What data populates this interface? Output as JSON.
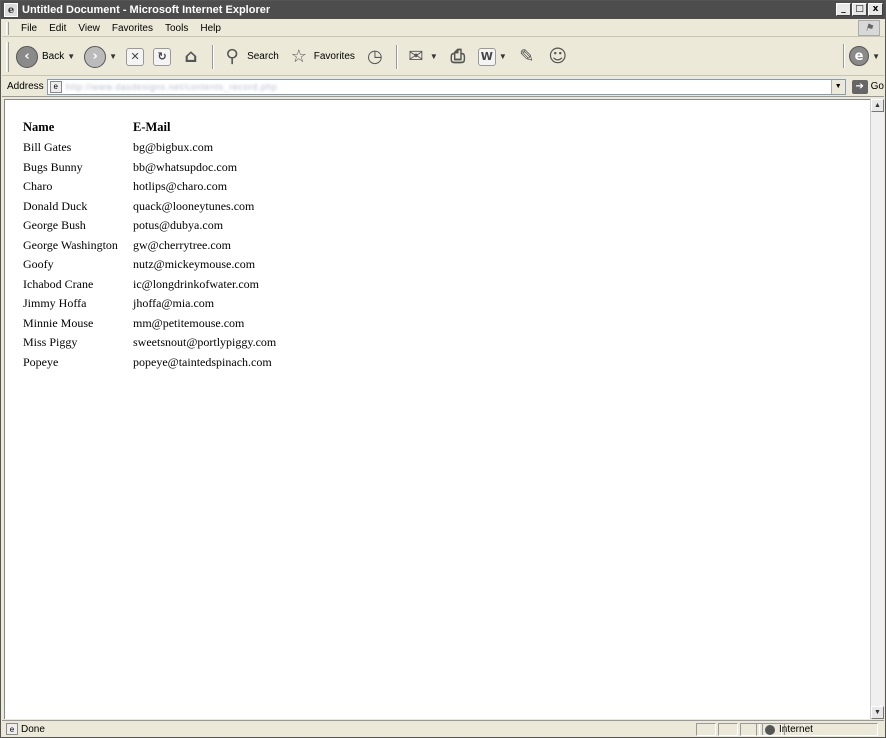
{
  "window": {
    "title": "Untitled Document - Microsoft Internet Explorer",
    "controls": {
      "minimize": "_",
      "maximize": "□",
      "close": "x"
    }
  },
  "menu": {
    "items": [
      "File",
      "Edit",
      "View",
      "Favorites",
      "Tools",
      "Help"
    ]
  },
  "toolbar": {
    "back_label": "Back",
    "search_label": "Search",
    "favorites_label": "Favorites",
    "icons": [
      "back-icon",
      "forward-icon",
      "stop-icon",
      "refresh-icon",
      "home-icon",
      "search-icon",
      "favorites-star-icon",
      "history-icon",
      "mail-icon",
      "print-icon",
      "edit-icon",
      "discuss-icon",
      "messenger-icon",
      "research-icon"
    ]
  },
  "address": {
    "label": "Address",
    "url": "http://www.dasdesigns.net/contents_record.php",
    "go_label": "Go"
  },
  "table": {
    "headers": {
      "name": "Name",
      "email": "E-Mail"
    },
    "rows": [
      {
        "name": "Bill Gates",
        "email": "bg@bigbux.com"
      },
      {
        "name": "Bugs Bunny",
        "email": "bb@whatsupdoc.com"
      },
      {
        "name": "Charo",
        "email": "hotlips@charo.com"
      },
      {
        "name": "Donald Duck",
        "email": "quack@looneytunes.com"
      },
      {
        "name": "George Bush",
        "email": "potus@dubya.com"
      },
      {
        "name": "George Washington",
        "email": "gw@cherrytree.com"
      },
      {
        "name": "Goofy",
        "email": "nutz@mickeymouse.com"
      },
      {
        "name": "Ichabod Crane",
        "email": "ic@longdrinkofwater.com"
      },
      {
        "name": "Jimmy Hoffa",
        "email": "jhoffa@mia.com"
      },
      {
        "name": "Minnie Mouse",
        "email": "mm@petitemouse.com"
      },
      {
        "name": "Miss Piggy",
        "email": "sweetsnout@portlypiggy.com"
      },
      {
        "name": "Popeye",
        "email": "popeye@taintedspinach.com"
      }
    ]
  },
  "status": {
    "text": "Done",
    "zone": "Internet"
  }
}
